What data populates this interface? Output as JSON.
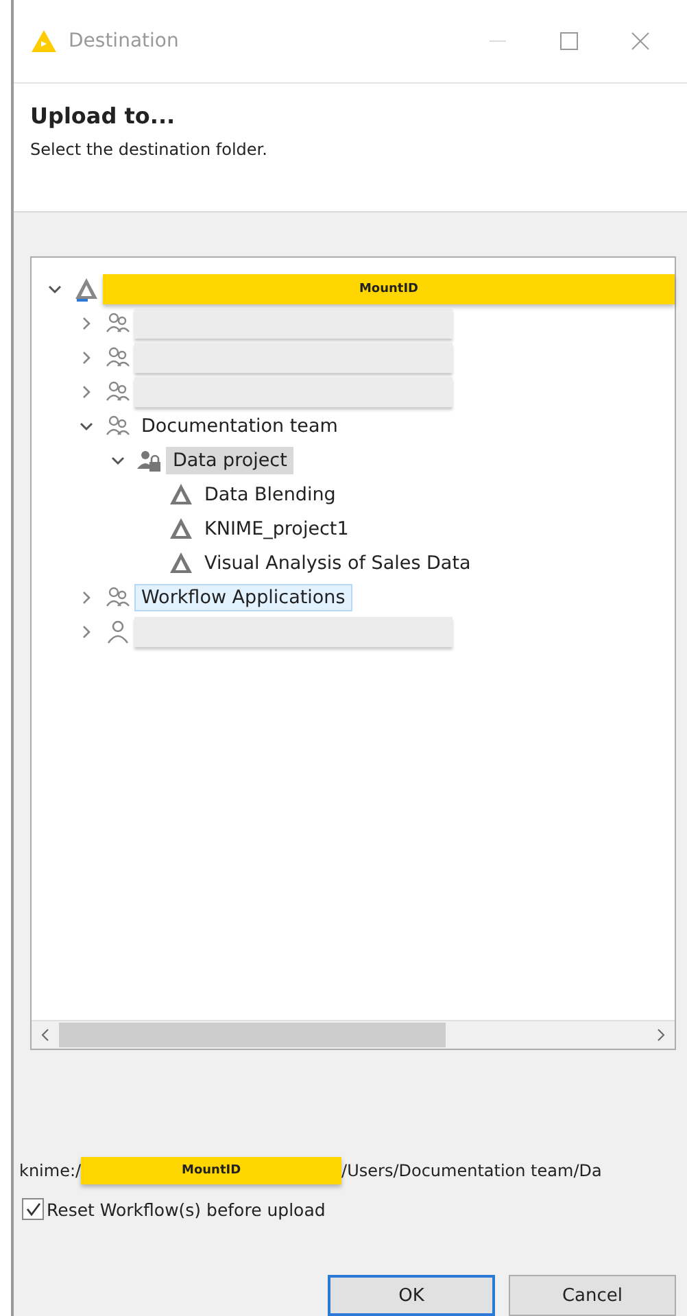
{
  "window": {
    "title": "Destination"
  },
  "header": {
    "title": "Upload to...",
    "subtitle": "Select the destination folder."
  },
  "tree": [
    {
      "kind": "mount",
      "redacted": true,
      "label": "MountID",
      "expanded": true,
      "children": [
        {
          "kind": "group",
          "redacted": true,
          "expanded": false
        },
        {
          "kind": "group",
          "redacted": true,
          "expanded": false
        },
        {
          "kind": "group",
          "redacted": true,
          "expanded": false
        },
        {
          "kind": "group",
          "label": "Documentation team",
          "expanded": true,
          "selected": false,
          "hovered": false,
          "children": [
            {
              "kind": "space",
              "label": "Data project",
              "expanded": true,
              "selected": true,
              "hovered": false,
              "children": [
                {
                  "kind": "workflow",
                  "label": "Data Blending",
                  "selected": false,
                  "hovered": false
                },
                {
                  "kind": "workflow",
                  "label": "KNIME_project1",
                  "selected": false,
                  "hovered": false
                },
                {
                  "kind": "workflow",
                  "label": "Visual Analysis of Sales Data",
                  "selected": false,
                  "hovered": false
                }
              ]
            }
          ]
        },
        {
          "kind": "group",
          "label": "Workflow Applications",
          "expanded": false,
          "selected": false,
          "hovered": true
        },
        {
          "kind": "user",
          "redacted": true,
          "expanded": false
        }
      ]
    }
  ],
  "path": {
    "prefix": "knime:/",
    "redacted_part": "MountID",
    "suffix": "/Users/Documentation team/Da"
  },
  "reset_option": {
    "label": "Reset Workflow(s) before upload",
    "checked": true
  },
  "buttons": [
    {
      "label": "OK",
      "default": true
    },
    {
      "label": "Cancel",
      "default": false
    }
  ]
}
